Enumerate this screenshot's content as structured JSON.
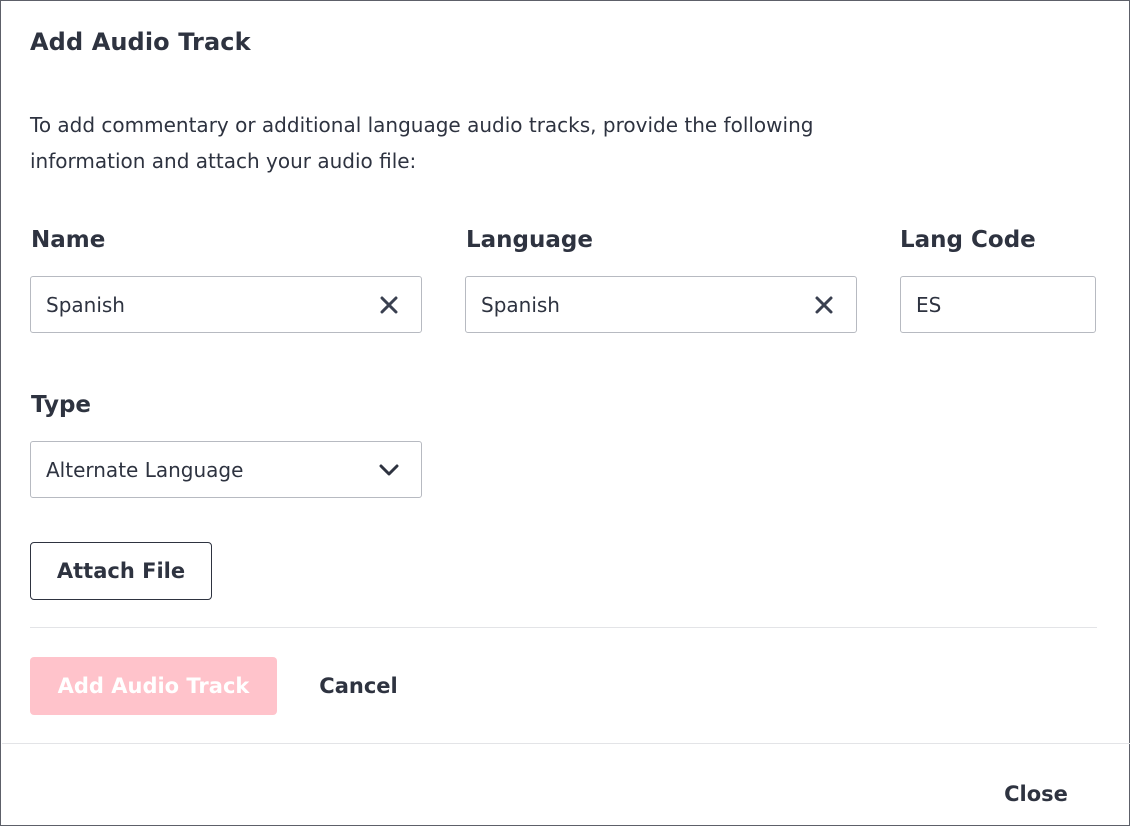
{
  "dialog": {
    "title": "Add Audio Track",
    "intro": "To add commentary or additional language audio tracks, provide the following information and attach your audio file:"
  },
  "form": {
    "name": {
      "label": "Name",
      "value": "Spanish",
      "clear_icon": "close-icon"
    },
    "language": {
      "label": "Language",
      "value": "Spanish",
      "clear_icon": "close-icon"
    },
    "lang_code": {
      "label": "Lang Code",
      "value": "ES"
    },
    "type": {
      "label": "Type",
      "selected": "Alternate Language",
      "icon": "chevron-down-icon"
    }
  },
  "actions": {
    "attach_label": "Attach File",
    "add_label": "Add Audio Track",
    "cancel_label": "Cancel",
    "close_label": "Close"
  },
  "colors": {
    "text": "#2e3340",
    "border": "#b7bac1",
    "primary_disabled": "#ffc3cb",
    "divider": "#e3e4e7"
  }
}
